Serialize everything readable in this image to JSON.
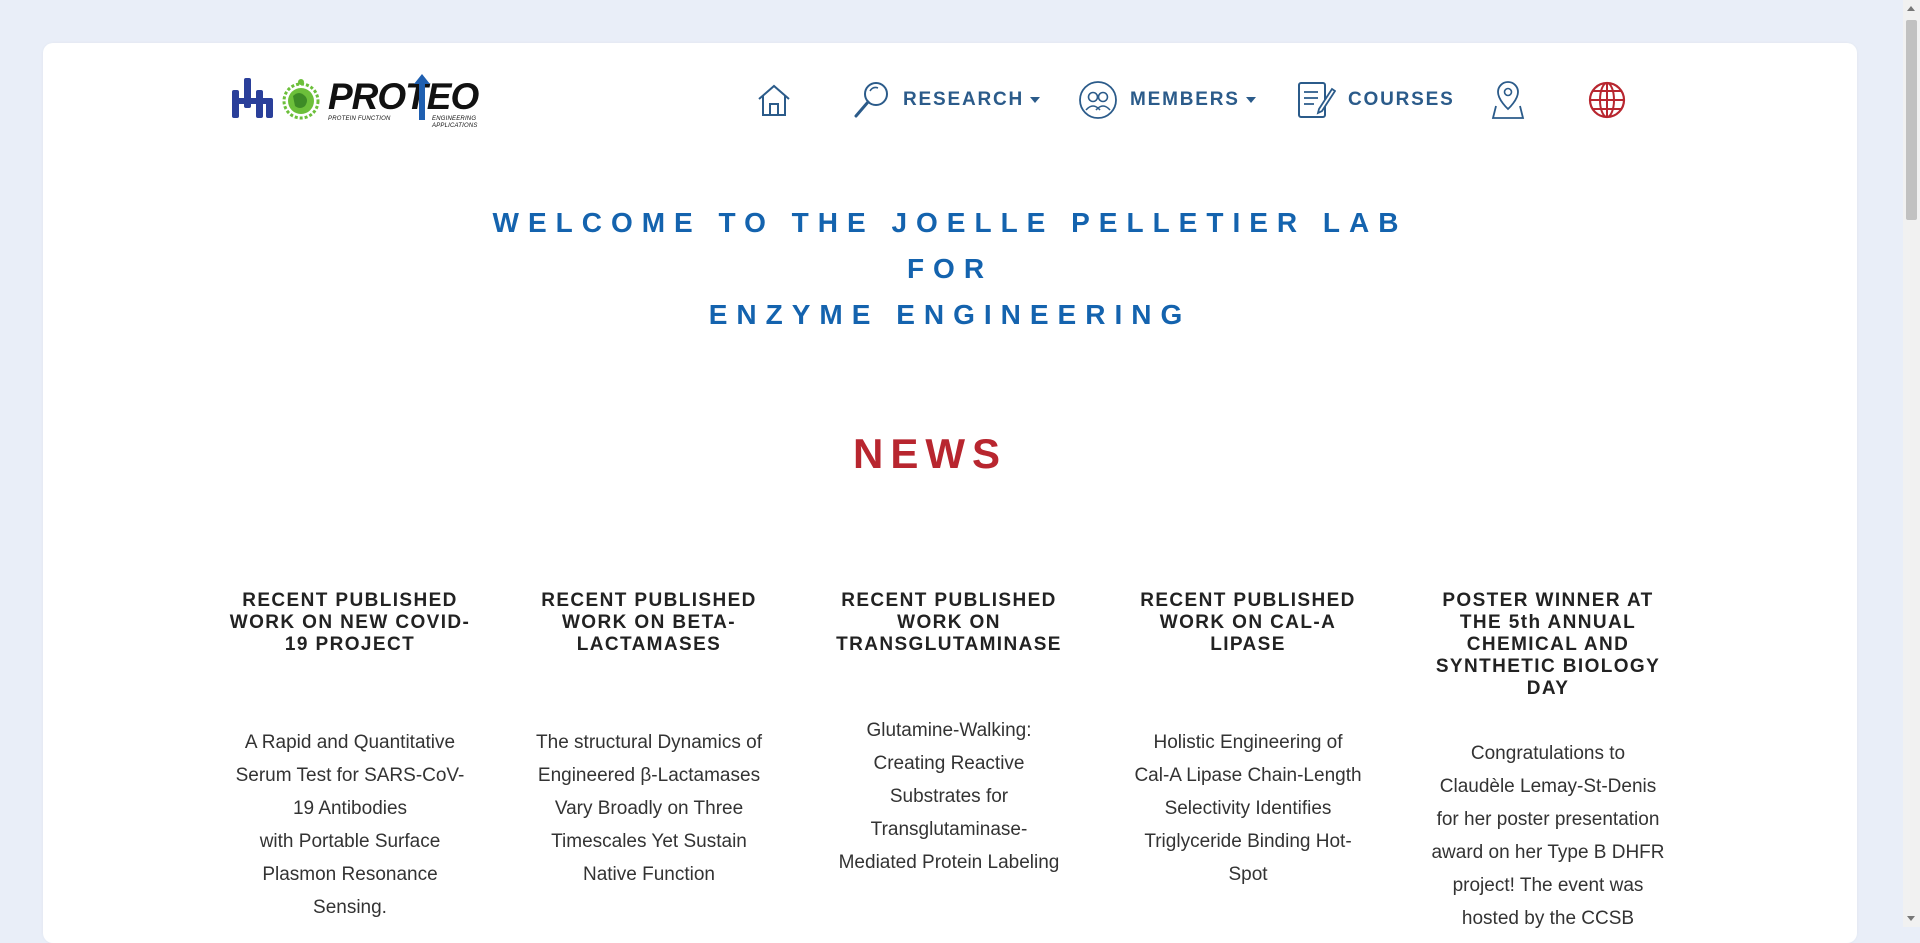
{
  "logo": {
    "text": "PROTEO",
    "sub1": "PROTEIN FUNCTION",
    "sub2": "ENGINEERING APPLICATIONS"
  },
  "nav": {
    "home_icon": "home-icon",
    "research": {
      "label": "RESEARCH",
      "icon": "magnifier-icon"
    },
    "members": {
      "label": "MEMBERS",
      "icon": "people-icon"
    },
    "courses": {
      "label": "COURSES",
      "icon": "notepad-icon"
    },
    "location_icon": "map-pin-icon",
    "language_icon": "globe-icon",
    "colors": {
      "nav": "#2b5b8a",
      "globe": "#b8262f"
    }
  },
  "welcome": {
    "line1": "WELCOME TO THE JOELLE PELLETIER LAB",
    "line2": "FOR",
    "line3": "ENZYME ENGINEERING",
    "color": "#1463ae"
  },
  "news": {
    "title": "NEWS",
    "color": "#b8262f",
    "items": [
      {
        "heading": [
          "RECENT PUBLISHED",
          "WORK ON NEW COVID-",
          "19 PROJECT"
        ],
        "body": [
          "A Rapid and Quantitative",
          "Serum Test for SARS-CoV-",
          "19 Antibodies",
          "with Portable Surface",
          "Plasmon Resonance",
          "Sensing."
        ]
      },
      {
        "heading": [
          "RECENT PUBLISHED",
          "WORK ON BETA-",
          "LACTAMASES"
        ],
        "body": [
          "The structural Dynamics of",
          "Engineered β-Lactamases",
          "Vary Broadly on Three",
          "Timescales Yet Sustain",
          "Native Function"
        ]
      },
      {
        "heading": [
          "RECENT PUBLISHED",
          "WORK ON",
          "TRANSGLUTAMINASE"
        ],
        "body": [
          "Glutamine-Walking:",
          "Creating Reactive",
          "Substrates for",
          "Transglutaminase-",
          "Mediated Protein Labeling"
        ]
      },
      {
        "heading": [
          "RECENT PUBLISHED",
          "WORK ON CAL-A",
          "LIPASE"
        ],
        "body": [
          "Holistic Engineering of",
          "Cal-A Lipase Chain-Length",
          "Selectivity Identifies",
          "Triglyceride Binding Hot-",
          "Spot"
        ]
      },
      {
        "heading": [
          "POSTER WINNER AT",
          "THE 5th ANNUAL",
          "CHEMICAL AND",
          "SYNTHETIC BIOLOGY",
          "DAY"
        ],
        "body": [
          "Congratulations to",
          "Claudèle Lemay-St-Denis",
          "for her poster presentation",
          "award on her Type B DHFR",
          "project! The event was",
          "hosted by the CCSB"
        ]
      }
    ]
  }
}
